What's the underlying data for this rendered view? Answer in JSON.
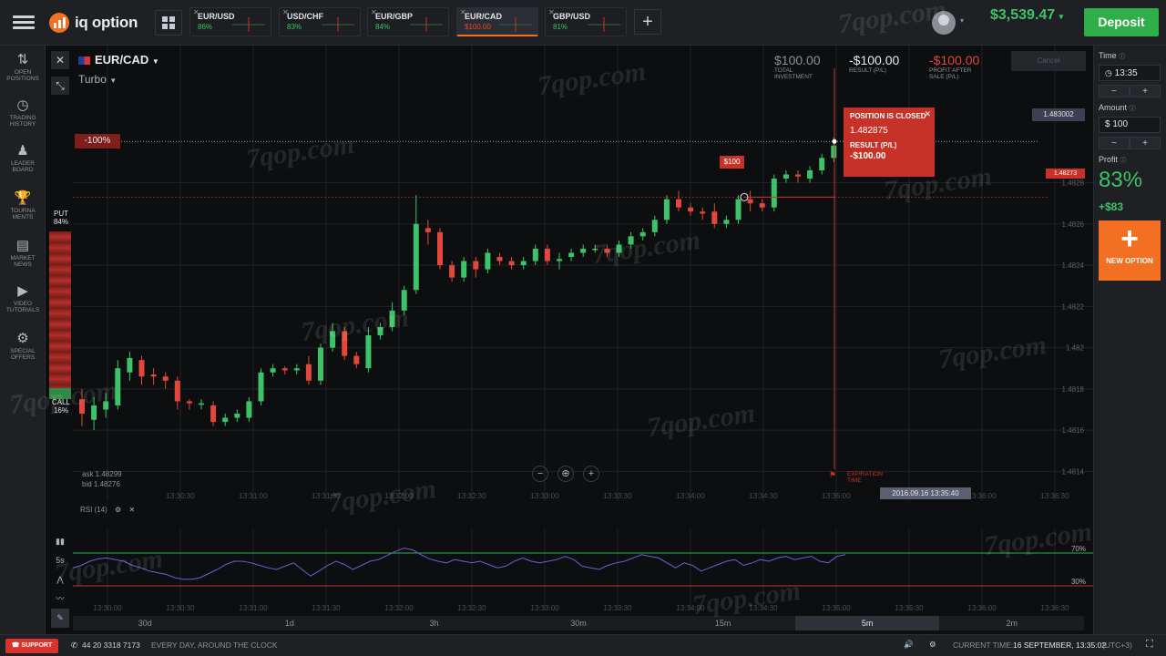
{
  "app": {
    "name": "iq option"
  },
  "top_assets": [
    {
      "name": "EUR/USD",
      "percent": "86%",
      "active": false
    },
    {
      "name": "USD/CHF",
      "percent": "83%",
      "active": false
    },
    {
      "name": "EUR/GBP",
      "percent": "84%",
      "active": false
    },
    {
      "name": "EUR/CAD",
      "percent": "$100.00",
      "active": true
    },
    {
      "name": "GBP/USD",
      "percent": "81%",
      "active": false
    }
  ],
  "account": {
    "balance": "$3,539.47",
    "deposit_label": "Deposit"
  },
  "left_nav": [
    {
      "label": "OPEN POSITIONS",
      "icon": "arrows-updown-icon"
    },
    {
      "label": "TRADING HISTORY",
      "icon": "history-icon"
    },
    {
      "label": "LEADER BOARD",
      "icon": "leaderboard-icon"
    },
    {
      "label": "TOURNA MENTS",
      "icon": "trophy-icon"
    },
    {
      "label": "MARKET NEWS",
      "icon": "news-icon"
    },
    {
      "label": "VIDEO TUTORIALS",
      "icon": "play-icon"
    },
    {
      "label": "SPECIAL OFFERS",
      "icon": "gear-icon"
    }
  ],
  "chart_header": {
    "asset": "EUR/CAD",
    "mode": "Turbo",
    "total_investment": "$100.00",
    "total_investment_label": "TOTAL INVESTMENT",
    "result": "-$100.00",
    "result_label": "RESULT (P/L)",
    "profit_after_sale": "-$100.00",
    "profit_after_sale_label": "PROFIT AFTER SALE (P/L)",
    "cancel_label": "Cancel"
  },
  "sentiment": {
    "put_label": "PUT",
    "put_pct": "84%",
    "call_label": "CALL",
    "call_pct": "16%",
    "pct_marker": "-100%"
  },
  "popup": {
    "title": "POSITION IS CLOSED",
    "price": "1.482875",
    "result_label": "RESULT (P/L)",
    "result": "-$100.00"
  },
  "trade_tag": "$100",
  "price_labels": {
    "current": "1.483002",
    "strike": "1.48273"
  },
  "y_ticks": [
    "1.4828",
    "1.4826",
    "1.4824",
    "1.4822",
    "1.482",
    "1.4818",
    "1.4816",
    "1.4814"
  ],
  "x_ticks": [
    "13:30:30",
    "13:31:00",
    "13:31:30",
    "13:32:00",
    "13:32:30",
    "13:33:00",
    "13:33:30",
    "13:34:00",
    "13:34:30",
    "13:35:00",
    "13:35:30",
    "13:36:00",
    "13:36:30"
  ],
  "rsi_x_ticks": [
    "13:30:00",
    "13:30:30",
    "13:31:00",
    "13:31:30",
    "13:32:00",
    "13:32:30",
    "13:33:00",
    "13:33:30",
    "13:34:00",
    "13:34:30",
    "13:35:00",
    "13:35:30",
    "13:36:00",
    "13:36:30"
  ],
  "quote": {
    "ask": "ask 1.48299",
    "bid": "bid 1.48276"
  },
  "expiration": {
    "label": "EXPIRATION TIME",
    "timestamp": "2016.09.16 13:35:40"
  },
  "rsi": {
    "label": "RSI (14)",
    "upper": "70%",
    "lower": "30%",
    "tool_period": "5s"
  },
  "timeframes": [
    "30d",
    "1d",
    "3h",
    "30m",
    "15m",
    "5m",
    "2m"
  ],
  "selected_timeframe": "5m",
  "right_panel": {
    "time_label": "Time",
    "time_value": "13:35",
    "amount_label": "Amount",
    "amount_value": "$ 100",
    "profit_label": "Profit",
    "profit_pct": "83%",
    "profit_value": "+$83",
    "new_option_label": "NEW OPTION"
  },
  "footer": {
    "support_label": "SUPPORT",
    "phone": "44 20 3318 7173",
    "tagline": "EVERY DAY, AROUND THE CLOCK",
    "current_time_label": "CURRENT TIME:",
    "current_time": "16 SEPTEMBER, 13:35:02",
    "tz": "(UTC+3)"
  },
  "watermark": "7qop.com",
  "colors": {
    "accent": "#f36f21",
    "up": "#3cc36a",
    "down": "#e2473a",
    "deposit": "#2fae4a"
  },
  "chart_data": {
    "type": "candlestick",
    "ylim": [
      1.4813,
      1.4832
    ],
    "candles": [
      [
        1.48175,
        1.48168,
        1.4818,
        1.48162
      ],
      [
        1.48165,
        1.48172,
        1.48176,
        1.4816
      ],
      [
        1.4817,
        1.48174,
        1.48178,
        1.48166
      ],
      [
        1.48172,
        1.4819,
        1.48194,
        1.4817
      ],
      [
        1.48188,
        1.48195,
        1.48198,
        1.48184
      ],
      [
        1.48194,
        1.48186,
        1.48196,
        1.48182
      ],
      [
        1.48187,
        1.48186,
        1.4819,
        1.48182
      ],
      [
        1.48186,
        1.48184,
        1.48188,
        1.4818
      ],
      [
        1.48184,
        1.48174,
        1.48186,
        1.4817
      ],
      [
        1.48174,
        1.48173,
        1.48175,
        1.4817
      ],
      [
        1.48173,
        1.48173,
        1.48175,
        1.4817
      ],
      [
        1.48172,
        1.48164,
        1.48174,
        1.48162
      ],
      [
        1.48164,
        1.48166,
        1.48168,
        1.48162
      ],
      [
        1.48166,
        1.48168,
        1.4817,
        1.48164
      ],
      [
        1.48166,
        1.48174,
        1.48176,
        1.48164
      ],
      [
        1.48174,
        1.48188,
        1.4819,
        1.48172
      ],
      [
        1.48188,
        1.4819,
        1.48192,
        1.48186
      ],
      [
        1.4819,
        1.48189,
        1.48191,
        1.48187
      ],
      [
        1.48189,
        1.4819,
        1.48192,
        1.48187
      ],
      [
        1.48192,
        1.48184,
        1.48196,
        1.48182
      ],
      [
        1.48184,
        1.482,
        1.48202,
        1.48182
      ],
      [
        1.482,
        1.48208,
        1.48212,
        1.48198
      ],
      [
        1.48208,
        1.48196,
        1.4821,
        1.48194
      ],
      [
        1.48196,
        1.48192,
        1.48198,
        1.4819
      ],
      [
        1.4819,
        1.48206,
        1.4821,
        1.48188
      ],
      [
        1.48206,
        1.4821,
        1.48212,
        1.48204
      ],
      [
        1.4821,
        1.48218,
        1.48222,
        1.48208
      ],
      [
        1.48218,
        1.48228,
        1.4823,
        1.48216
      ],
      [
        1.48228,
        1.4826,
        1.48274,
        1.48226
      ],
      [
        1.48258,
        1.48256,
        1.48262,
        1.4825
      ],
      [
        1.48256,
        1.4824,
        1.48258,
        1.48238
      ],
      [
        1.4824,
        1.48234,
        1.48242,
        1.48232
      ],
      [
        1.48234,
        1.48242,
        1.48244,
        1.48232
      ],
      [
        1.48242,
        1.48238,
        1.48244,
        1.48234
      ],
      [
        1.48238,
        1.48246,
        1.48248,
        1.48236
      ],
      [
        1.48244,
        1.48242,
        1.48246,
        1.4824
      ],
      [
        1.48242,
        1.4824,
        1.48244,
        1.48238
      ],
      [
        1.4824,
        1.48242,
        1.48244,
        1.48238
      ],
      [
        1.48242,
        1.48248,
        1.4825,
        1.4824
      ],
      [
        1.48248,
        1.48242,
        1.4825,
        1.4824
      ],
      [
        1.48242,
        1.48243,
        1.48246,
        1.48238
      ],
      [
        1.48244,
        1.48246,
        1.48248,
        1.48242
      ],
      [
        1.48246,
        1.48248,
        1.4825,
        1.48244
      ],
      [
        1.48248,
        1.48248,
        1.4825,
        1.48246
      ],
      [
        1.48248,
        1.48246,
        1.4825,
        1.48244
      ],
      [
        1.48246,
        1.4825,
        1.48252,
        1.48244
      ],
      [
        1.4825,
        1.48254,
        1.48256,
        1.48248
      ],
      [
        1.48254,
        1.48256,
        1.48258,
        1.48252
      ],
      [
        1.48256,
        1.48262,
        1.48264,
        1.48254
      ],
      [
        1.48262,
        1.48272,
        1.48274,
        1.4826
      ],
      [
        1.48272,
        1.48268,
        1.48276,
        1.48266
      ],
      [
        1.48268,
        1.48266,
        1.4827,
        1.48264
      ],
      [
        1.48266,
        1.48265,
        1.48268,
        1.48262
      ],
      [
        1.48266,
        1.4826,
        1.4827,
        1.48258
      ],
      [
        1.4826,
        1.48262,
        1.48264,
        1.48258
      ],
      [
        1.48262,
        1.48272,
        1.48274,
        1.4826
      ],
      [
        1.48272,
        1.4827,
        1.48276,
        1.48266
      ],
      [
        1.4827,
        1.48268,
        1.48272,
        1.48266
      ],
      [
        1.48268,
        1.48282,
        1.48284,
        1.48266
      ],
      [
        1.48282,
        1.48284,
        1.48286,
        1.4828
      ],
      [
        1.48284,
        1.48283,
        1.48286,
        1.4828
      ],
      [
        1.48282,
        1.48286,
        1.48288,
        1.4828
      ],
      [
        1.48286,
        1.48292,
        1.48294,
        1.48284
      ],
      [
        1.48292,
        1.48298,
        1.48302,
        1.4829
      ]
    ],
    "rsi": [
      52,
      55,
      60,
      63,
      64,
      62,
      60,
      55,
      52,
      48,
      46,
      44,
      40,
      38,
      38,
      40,
      45,
      50,
      56,
      60,
      60,
      58,
      55,
      52,
      50,
      54,
      58,
      50,
      42,
      48,
      55,
      60,
      56,
      50,
      55,
      60,
      62,
      67,
      72,
      76,
      74,
      68,
      63,
      60,
      58,
      62,
      60,
      58,
      60,
      56,
      52,
      54,
      60,
      64,
      60,
      58,
      60,
      62,
      66,
      62,
      54,
      52,
      50,
      55,
      58,
      60,
      64,
      68,
      66,
      64,
      58,
      52,
      58,
      55,
      48,
      52,
      56,
      60,
      62,
      55,
      58,
      62,
      60,
      64,
      66,
      62,
      64,
      66,
      60,
      58,
      66,
      68
    ],
    "rsi_ylim": [
      0,
      100
    ],
    "rsi_levels": [
      70,
      30
    ]
  }
}
